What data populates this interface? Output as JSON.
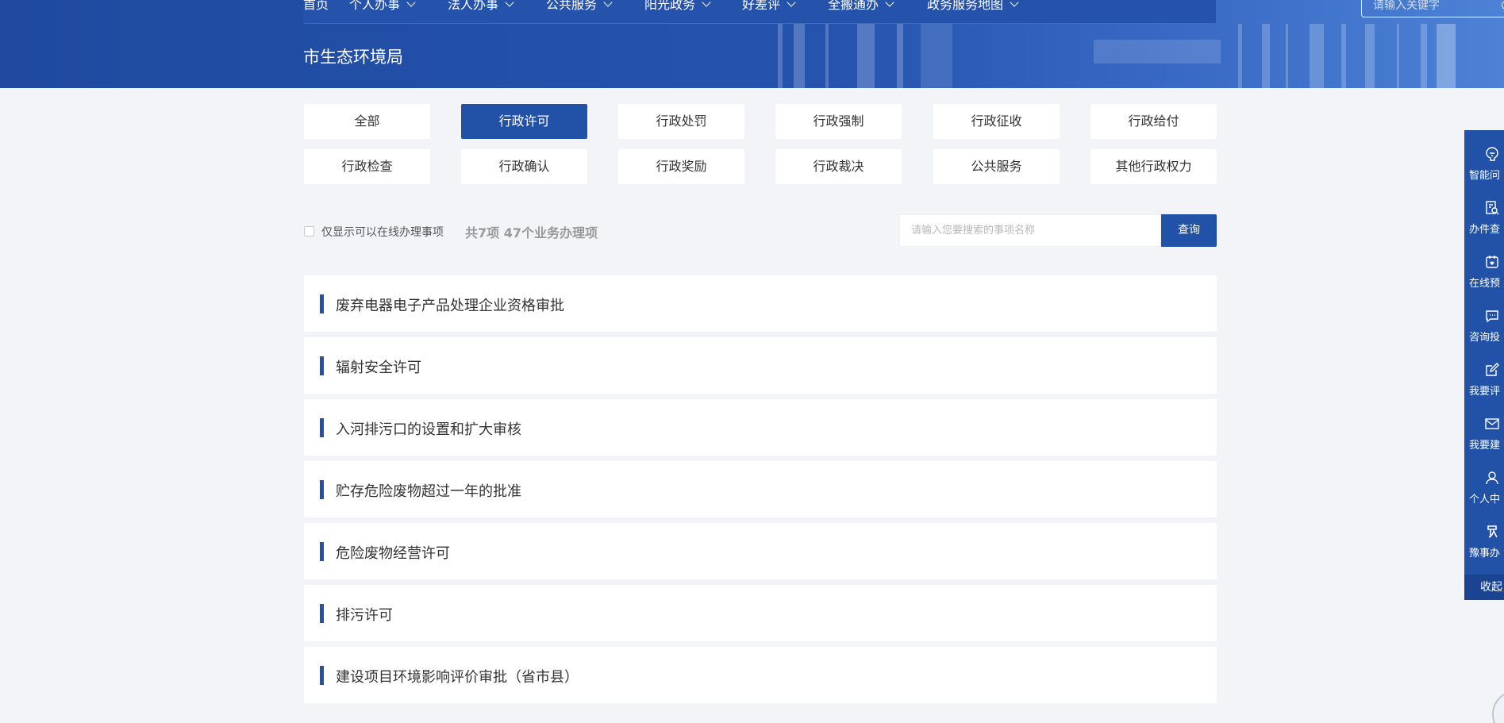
{
  "nav": {
    "items": [
      {
        "label": "首页",
        "has_dropdown": false
      },
      {
        "label": "个人办事",
        "has_dropdown": true
      },
      {
        "label": "法人办事",
        "has_dropdown": true
      },
      {
        "label": "公共服务",
        "has_dropdown": true
      },
      {
        "label": "阳光政务",
        "has_dropdown": true
      },
      {
        "label": "好差评",
        "has_dropdown": true
      },
      {
        "label": "全搬通办",
        "has_dropdown": true
      },
      {
        "label": "政务服务地图",
        "has_dropdown": true
      }
    ],
    "search_placeholder": "请输入关键字"
  },
  "page": {
    "title": "市生态环境局"
  },
  "categories": [
    {
      "label": "全部",
      "active": false
    },
    {
      "label": "行政许可",
      "active": true
    },
    {
      "label": "行政处罚",
      "active": false
    },
    {
      "label": "行政强制",
      "active": false
    },
    {
      "label": "行政征收",
      "active": false
    },
    {
      "label": "行政给付",
      "active": false
    },
    {
      "label": "行政检查",
      "active": false
    },
    {
      "label": "行政确认",
      "active": false
    },
    {
      "label": "行政奖励",
      "active": false
    },
    {
      "label": "行政裁决",
      "active": false
    },
    {
      "label": "公共服务",
      "active": false
    },
    {
      "label": "其他行政权力",
      "active": false
    }
  ],
  "filter": {
    "online_only_label": "仅显示可以在线办理事项",
    "online_only_checked": false,
    "count_text": "共7项 47个业务办理项",
    "search_placeholder": "请输入您要搜索的事项名称",
    "search_button": "查询"
  },
  "items": [
    {
      "name": "废弃电器电子产品处理企业资格审批"
    },
    {
      "name": "辐射安全许可"
    },
    {
      "name": "入河排污口的设置和扩大审核"
    },
    {
      "name": "贮存危险废物超过一年的批准"
    },
    {
      "name": "危险废物经营许可"
    },
    {
      "name": "排污许可"
    },
    {
      "name": "建设项目环境影响评价审批（省市县）"
    }
  ],
  "sidebar": {
    "items": [
      {
        "label": "智能问",
        "icon": "robot-icon"
      },
      {
        "label": "办件查",
        "icon": "document-search-icon"
      },
      {
        "label": "在线预",
        "icon": "calendar-icon"
      },
      {
        "label": "咨询投",
        "icon": "chat-icon"
      },
      {
        "label": "我要评",
        "icon": "edit-icon"
      },
      {
        "label": "我要建",
        "icon": "mail-icon"
      },
      {
        "label": "个人中",
        "icon": "user-icon"
      },
      {
        "label": "豫事办",
        "icon": "app-logo-icon"
      }
    ],
    "collapse_label": "收起"
  },
  "colors": {
    "primary": "#2252a8",
    "header_gradient_end": "#4d82d6",
    "page_bg": "#f3f4f7"
  }
}
